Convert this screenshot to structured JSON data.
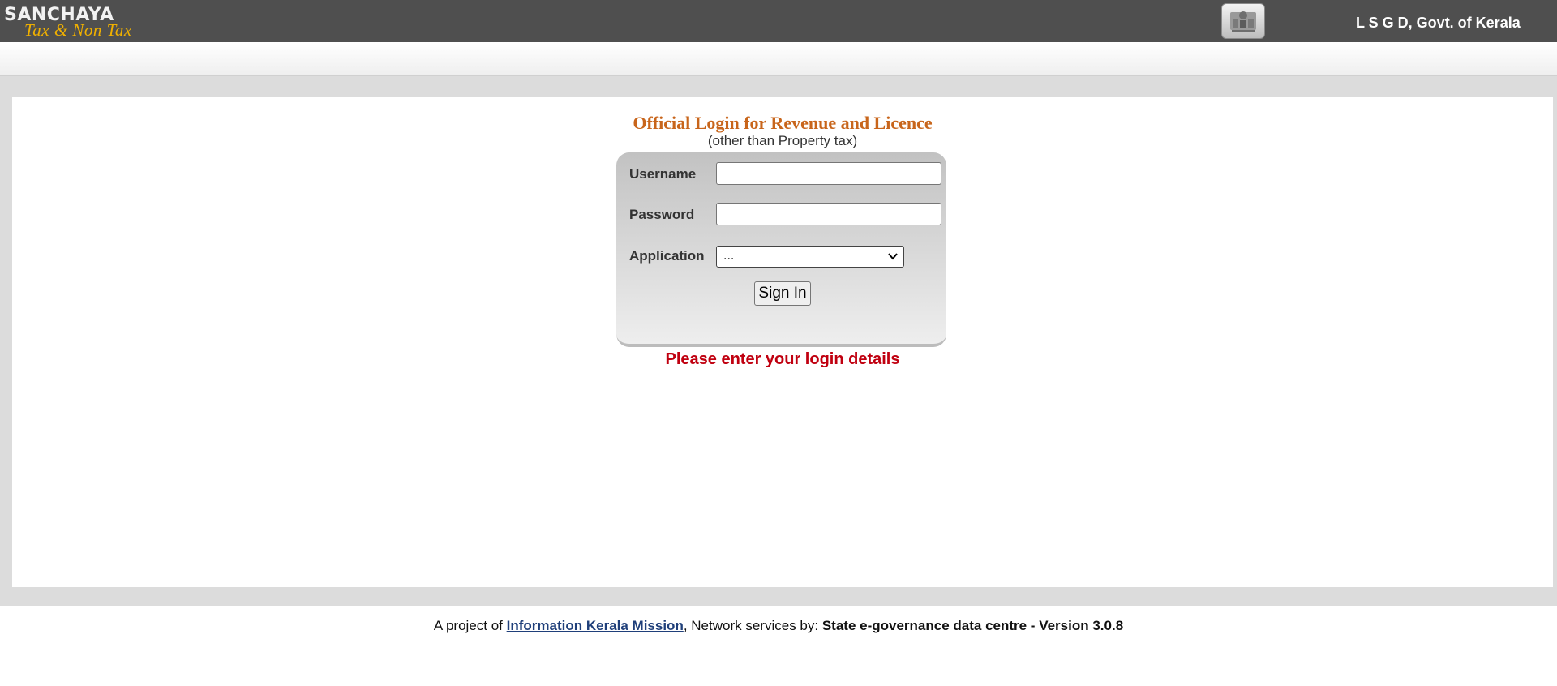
{
  "header": {
    "logo_main": "SANCHAYA",
    "logo_sub": "Tax & Non Tax",
    "emblem_icon": "kerala-emblem-icon",
    "department": "L S G D, Govt. of Kerala"
  },
  "login": {
    "title": "Official Login for Revenue and Licence",
    "subtitle": "(other than Property tax)",
    "username_label": "Username",
    "username_value": "",
    "password_label": "Password",
    "password_value": "",
    "application_label": "Application",
    "application_selected": "...",
    "sign_in_label": "Sign In",
    "message": "Please enter your login details"
  },
  "footer": {
    "prefix": "A project of ",
    "link_text": "Information Kerala Mission",
    "middle": ", Network services by: ",
    "provider": "State e-governance data centre - Version 3.0.8"
  },
  "colors": {
    "header_bg": "#4f4f4f",
    "logo_sub": "#f0b000",
    "title": "#c8651b",
    "message": "#c00010",
    "link": "#1f3f7a"
  }
}
